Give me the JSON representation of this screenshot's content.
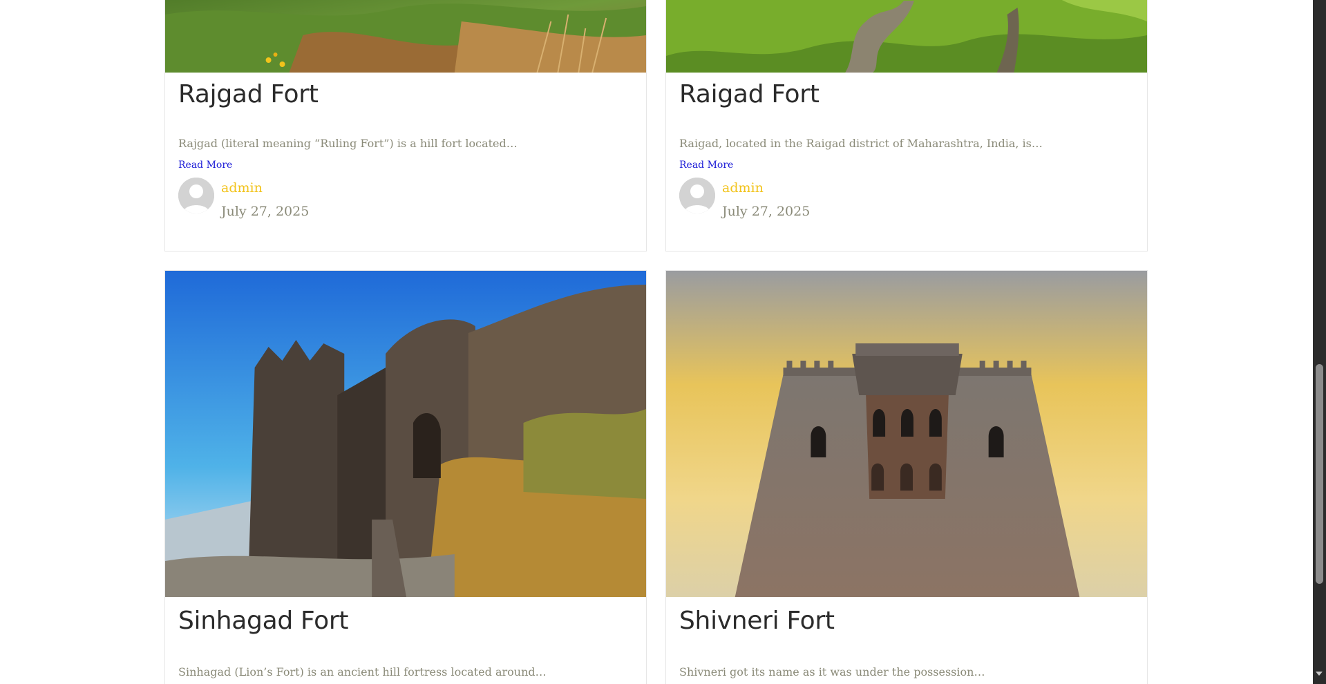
{
  "posts": [
    {
      "title": "Rajgad Fort",
      "excerpt": "Rajgad (literal meaning “Ruling Fort”) is a hill fort located…",
      "read_more": "Read More",
      "author": "admin",
      "date": "July 27, 2025"
    },
    {
      "title": "Raigad Fort",
      "excerpt": "Raigad, located in the Raigad district of Maharashtra, India, is…",
      "read_more": "Read More",
      "author": "admin",
      "date": "July 27, 2025"
    },
    {
      "title": "Sinhagad Fort",
      "excerpt": "Sinhagad (Lion’s Fort) is an ancient hill fortress located around…"
    },
    {
      "title": "Shivneri Fort",
      "excerpt": "Shivneri got its name as it was under the possession…"
    }
  ],
  "colors": {
    "author_link": "#f2c31b",
    "read_more_link": "#1a1ad6",
    "title_text": "#2b2b2b",
    "meta_text": "#8a8a78"
  }
}
